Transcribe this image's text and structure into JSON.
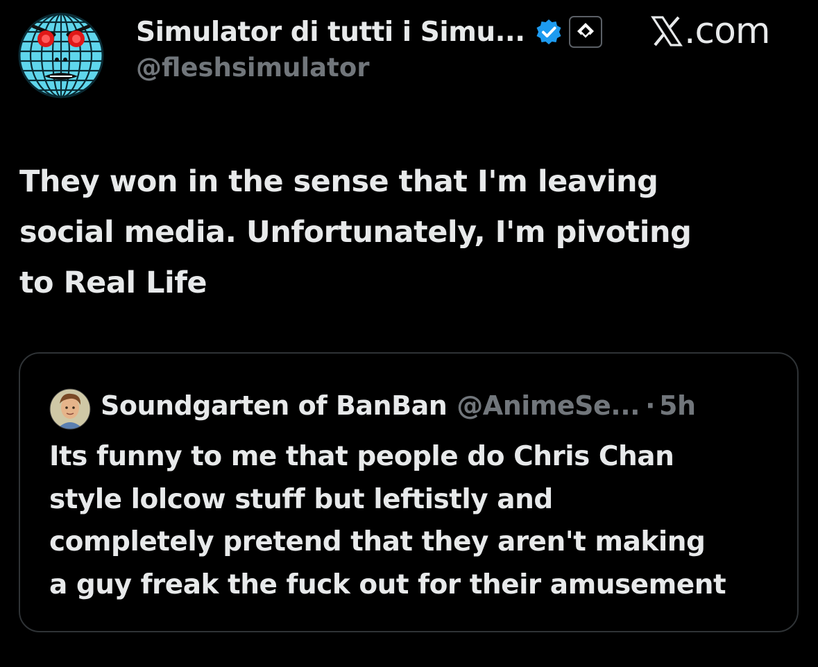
{
  "author": {
    "display_name": "Simulator di tutti i Simu...",
    "handle": "@fleshsimulator",
    "avatar_icon": "wireframe-globe-face-icon",
    "verified_icon": "verified-badge-icon",
    "affiliation_icon": "affiliate-badge-icon"
  },
  "watermark": {
    "logo_icon": "x-logo-icon",
    "suffix": ".com"
  },
  "tweet": {
    "text": "They won in the sense that I'm leaving\nsocial media. Unfortunately, I'm pivoting\nto Real Life"
  },
  "quoted_tweet": {
    "display_name": "Soundgarten of BanBan",
    "handle": "@AnimeSe...",
    "separator": "·",
    "time": "5h",
    "avatar_icon": "portrait-avatar-icon",
    "text": "Its funny to me that people do Chris Chan\nstyle lolcow stuff but leftistly and\ncompletely pretend that they aren't making\na guy freak the fuck out for their amusement"
  },
  "colors": {
    "background": "#000000",
    "primary_text": "#e7e9ea",
    "secondary_text": "#71767b",
    "border": "#2f3336",
    "verified_blue": "#1d9bf0",
    "globe_cyan": "#5fd6ec",
    "eye_red": "#e01818"
  }
}
